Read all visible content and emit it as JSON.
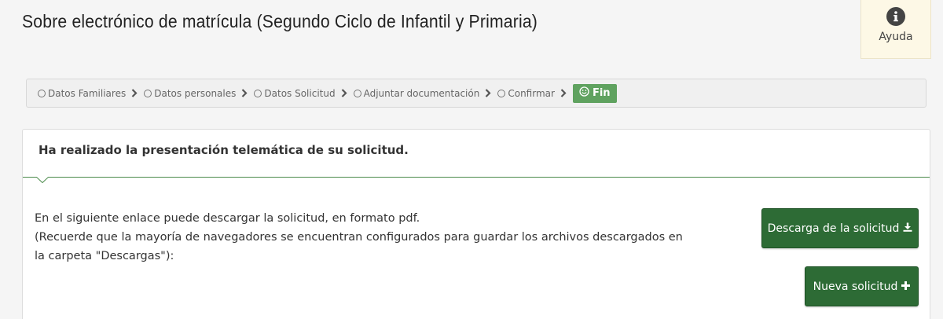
{
  "header": {
    "title": "Sobre electrónico de matrícula (Segundo Ciclo de Infantil y Primaria)",
    "help_label": "Ayuda",
    "help_icon": "info-circle-icon"
  },
  "breadcrumb": {
    "steps": [
      {
        "label": "Datos Familiares"
      },
      {
        "label": "Datos personales"
      },
      {
        "label": "Datos Solicitud"
      },
      {
        "label": "Adjuntar documentación"
      },
      {
        "label": "Confirmar"
      }
    ],
    "active": {
      "label": "Fin",
      "icon": "smile-icon"
    },
    "active_color": "#5fa25f"
  },
  "panel": {
    "heading": "Ha realizado la presentación telemática de su solicitud.",
    "line1": "En el siguiente enlace puede descargar la solicitud, en formato pdf.",
    "line2": "(Recuerde que la mayoría de navegadores se encuentran configurados para guardar los archivos descargados en la carpeta \"Descargas\"):"
  },
  "buttons": {
    "download_label": "Descarga de la solicitud",
    "download_icon": "download-icon",
    "new_label": "Nueva solicitud",
    "new_icon": "plus-icon",
    "color": "#2d6b35"
  }
}
